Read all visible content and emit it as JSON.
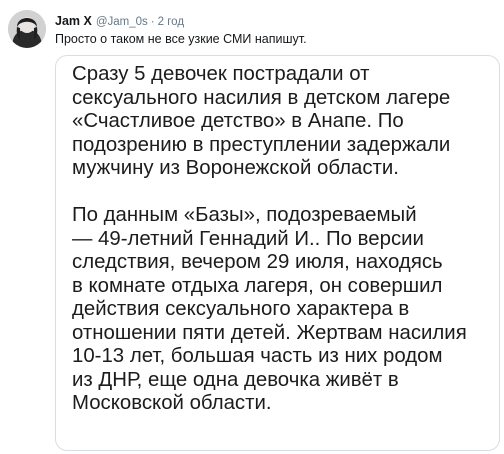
{
  "tweet": {
    "author_name": "Jam X",
    "author_handle": "@Jam_0s",
    "separator": "·",
    "time": "2 год",
    "text": "Просто о таком не все узкие СМИ напишут.",
    "avatar_icon": "user-avatar-photo"
  },
  "quote": {
    "paragraph1": [
      "Сразу 5 девочек пострадали от",
      "сексуального насилия в детском лагере",
      "«Счастливое детство» в Анапе. По",
      "подозрению в преступлении задержали",
      "мужчину из Воронежской области."
    ],
    "paragraph2": [
      "По данным «Базы», подозреваемый",
      "— 49-летний Геннадий И.. По версии",
      "следствия, вечером 29 июля, находясь",
      "в комнате отдыха лагеря, он совершил",
      "действия сексуального характера в",
      "отношении пяти детей. Жертвам насилия",
      "10-13 лет, большая часть из них родом",
      "из ДНР, еще одна девочка живёт в",
      "Московской области."
    ]
  }
}
